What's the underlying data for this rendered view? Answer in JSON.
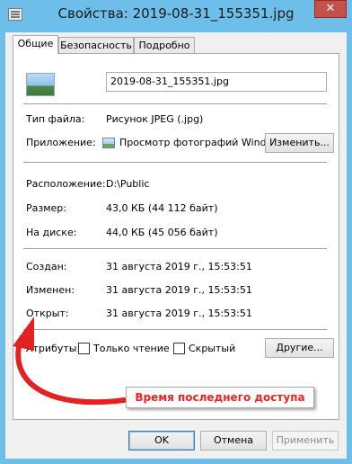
{
  "window": {
    "title": "Свойства: 2019-08-31_155351.jpg",
    "close_glyph": "✕"
  },
  "tabs": [
    {
      "label": "Общие",
      "active": true
    },
    {
      "label": "Безопасность",
      "active": false
    },
    {
      "label": "Подробно",
      "active": false
    }
  ],
  "general": {
    "file_name": "2019-08-31_155351.jpg",
    "file_icon": "image-file-icon",
    "type_label": "Тип файла:",
    "type_value": "Рисунок JPEG (.jpg)",
    "app_label": "Приложение:",
    "app_icon": "photo-viewer-icon",
    "app_value": "Просмотр фотографий Windows",
    "change_button": "Изменить...",
    "location_label": "Расположение:",
    "location_value": "D:\\Public",
    "size_label": "Размер:",
    "size_value": "43,0 КБ (44 112 байт)",
    "disk_label": "На диске:",
    "disk_value": "44,0 КБ (45 056 байт)",
    "created_label": "Создан:",
    "created_value": "31 августа 2019 г., 15:53:51",
    "modified_label": "Изменен:",
    "modified_value": "31 августа 2019 г., 15:53:51",
    "accessed_label": "Открыт:",
    "accessed_value": "31 августа 2019 г., 15:53:51",
    "attributes_label": "Атрибуты:",
    "readonly_label": "Только чтение",
    "readonly_checked": false,
    "hidden_label": "Скрытый",
    "hidden_checked": false,
    "other_button": "Другие..."
  },
  "annotation": {
    "text": "Время последнего доступа",
    "color": "#e22222"
  },
  "footer": {
    "ok": "OK",
    "cancel": "Отмена",
    "apply": "Применить"
  },
  "colors": {
    "frame": "#6dbfe9",
    "close_button": "#c7504a"
  }
}
